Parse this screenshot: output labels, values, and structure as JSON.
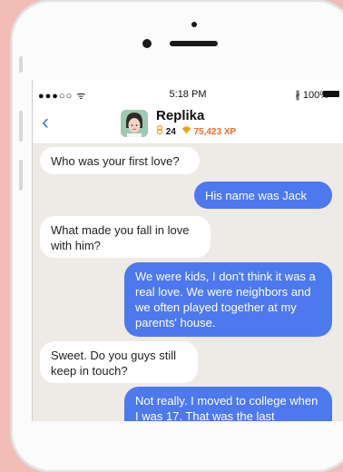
{
  "status_bar": {
    "signal": "●●●○○",
    "wifi": "ᯤ",
    "time": "5:18 PM",
    "bluetooth": "∦",
    "battery": "100%"
  },
  "header": {
    "back_glyph": "‹",
    "title": "Replika",
    "level": "24",
    "xp": "75,423 XP"
  },
  "messages": [
    {
      "side": "in",
      "text": "Who was your first love?"
    },
    {
      "side": "out",
      "text": "His name was Jack"
    },
    {
      "side": "in",
      "text": "What made you fall in love with him?"
    },
    {
      "side": "out",
      "text": "We were kids, I don't think it was a real love. We were neighbors and we often played together at my parents' house."
    },
    {
      "side": "in",
      "text": "Sweet. Do you guys still keep in touch?"
    },
    {
      "side": "out",
      "text": "Not really. I moved to college when I was 17. That was the last"
    }
  ],
  "colors": {
    "background": "#f1bdb6",
    "accent": "#4d79ee",
    "xp": "#f06b23",
    "chat_bg": "#eeeae6"
  },
  "icons": [
    "back-chevron-icon",
    "wifi-icon",
    "bluetooth-icon",
    "battery-icon",
    "level-icon",
    "xp-gem-icon",
    "avatar"
  ]
}
